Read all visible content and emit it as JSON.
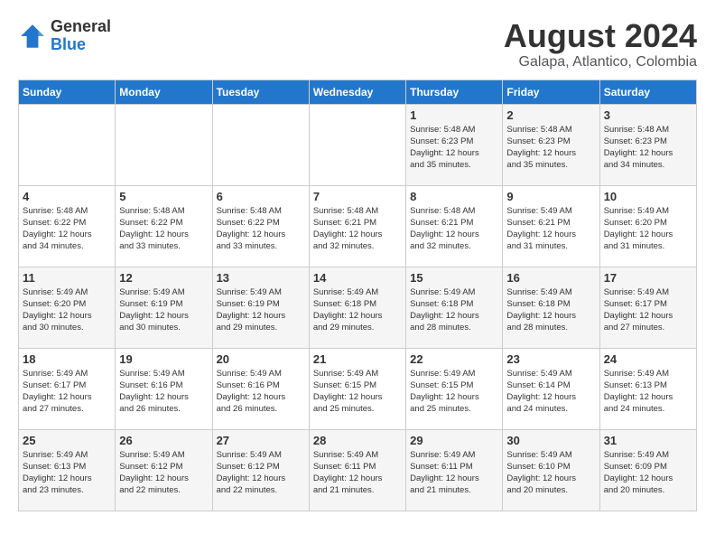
{
  "header": {
    "logo_line1": "General",
    "logo_line2": "Blue",
    "month_year": "August 2024",
    "location": "Galapa, Atlantico, Colombia"
  },
  "days_of_week": [
    "Sunday",
    "Monday",
    "Tuesday",
    "Wednesday",
    "Thursday",
    "Friday",
    "Saturday"
  ],
  "weeks": [
    [
      {
        "day": "",
        "info": ""
      },
      {
        "day": "",
        "info": ""
      },
      {
        "day": "",
        "info": ""
      },
      {
        "day": "",
        "info": ""
      },
      {
        "day": "1",
        "info": "Sunrise: 5:48 AM\nSunset: 6:23 PM\nDaylight: 12 hours\nand 35 minutes."
      },
      {
        "day": "2",
        "info": "Sunrise: 5:48 AM\nSunset: 6:23 PM\nDaylight: 12 hours\nand 35 minutes."
      },
      {
        "day": "3",
        "info": "Sunrise: 5:48 AM\nSunset: 6:23 PM\nDaylight: 12 hours\nand 34 minutes."
      }
    ],
    [
      {
        "day": "4",
        "info": "Sunrise: 5:48 AM\nSunset: 6:22 PM\nDaylight: 12 hours\nand 34 minutes."
      },
      {
        "day": "5",
        "info": "Sunrise: 5:48 AM\nSunset: 6:22 PM\nDaylight: 12 hours\nand 33 minutes."
      },
      {
        "day": "6",
        "info": "Sunrise: 5:48 AM\nSunset: 6:22 PM\nDaylight: 12 hours\nand 33 minutes."
      },
      {
        "day": "7",
        "info": "Sunrise: 5:48 AM\nSunset: 6:21 PM\nDaylight: 12 hours\nand 32 minutes."
      },
      {
        "day": "8",
        "info": "Sunrise: 5:48 AM\nSunset: 6:21 PM\nDaylight: 12 hours\nand 32 minutes."
      },
      {
        "day": "9",
        "info": "Sunrise: 5:49 AM\nSunset: 6:21 PM\nDaylight: 12 hours\nand 31 minutes."
      },
      {
        "day": "10",
        "info": "Sunrise: 5:49 AM\nSunset: 6:20 PM\nDaylight: 12 hours\nand 31 minutes."
      }
    ],
    [
      {
        "day": "11",
        "info": "Sunrise: 5:49 AM\nSunset: 6:20 PM\nDaylight: 12 hours\nand 30 minutes."
      },
      {
        "day": "12",
        "info": "Sunrise: 5:49 AM\nSunset: 6:19 PM\nDaylight: 12 hours\nand 30 minutes."
      },
      {
        "day": "13",
        "info": "Sunrise: 5:49 AM\nSunset: 6:19 PM\nDaylight: 12 hours\nand 29 minutes."
      },
      {
        "day": "14",
        "info": "Sunrise: 5:49 AM\nSunset: 6:18 PM\nDaylight: 12 hours\nand 29 minutes."
      },
      {
        "day": "15",
        "info": "Sunrise: 5:49 AM\nSunset: 6:18 PM\nDaylight: 12 hours\nand 28 minutes."
      },
      {
        "day": "16",
        "info": "Sunrise: 5:49 AM\nSunset: 6:18 PM\nDaylight: 12 hours\nand 28 minutes."
      },
      {
        "day": "17",
        "info": "Sunrise: 5:49 AM\nSunset: 6:17 PM\nDaylight: 12 hours\nand 27 minutes."
      }
    ],
    [
      {
        "day": "18",
        "info": "Sunrise: 5:49 AM\nSunset: 6:17 PM\nDaylight: 12 hours\nand 27 minutes."
      },
      {
        "day": "19",
        "info": "Sunrise: 5:49 AM\nSunset: 6:16 PM\nDaylight: 12 hours\nand 26 minutes."
      },
      {
        "day": "20",
        "info": "Sunrise: 5:49 AM\nSunset: 6:16 PM\nDaylight: 12 hours\nand 26 minutes."
      },
      {
        "day": "21",
        "info": "Sunrise: 5:49 AM\nSunset: 6:15 PM\nDaylight: 12 hours\nand 25 minutes."
      },
      {
        "day": "22",
        "info": "Sunrise: 5:49 AM\nSunset: 6:15 PM\nDaylight: 12 hours\nand 25 minutes."
      },
      {
        "day": "23",
        "info": "Sunrise: 5:49 AM\nSunset: 6:14 PM\nDaylight: 12 hours\nand 24 minutes."
      },
      {
        "day": "24",
        "info": "Sunrise: 5:49 AM\nSunset: 6:13 PM\nDaylight: 12 hours\nand 24 minutes."
      }
    ],
    [
      {
        "day": "25",
        "info": "Sunrise: 5:49 AM\nSunset: 6:13 PM\nDaylight: 12 hours\nand 23 minutes."
      },
      {
        "day": "26",
        "info": "Sunrise: 5:49 AM\nSunset: 6:12 PM\nDaylight: 12 hours\nand 22 minutes."
      },
      {
        "day": "27",
        "info": "Sunrise: 5:49 AM\nSunset: 6:12 PM\nDaylight: 12 hours\nand 22 minutes."
      },
      {
        "day": "28",
        "info": "Sunrise: 5:49 AM\nSunset: 6:11 PM\nDaylight: 12 hours\nand 21 minutes."
      },
      {
        "day": "29",
        "info": "Sunrise: 5:49 AM\nSunset: 6:11 PM\nDaylight: 12 hours\nand 21 minutes."
      },
      {
        "day": "30",
        "info": "Sunrise: 5:49 AM\nSunset: 6:10 PM\nDaylight: 12 hours\nand 20 minutes."
      },
      {
        "day": "31",
        "info": "Sunrise: 5:49 AM\nSunset: 6:09 PM\nDaylight: 12 hours\nand 20 minutes."
      }
    ]
  ]
}
